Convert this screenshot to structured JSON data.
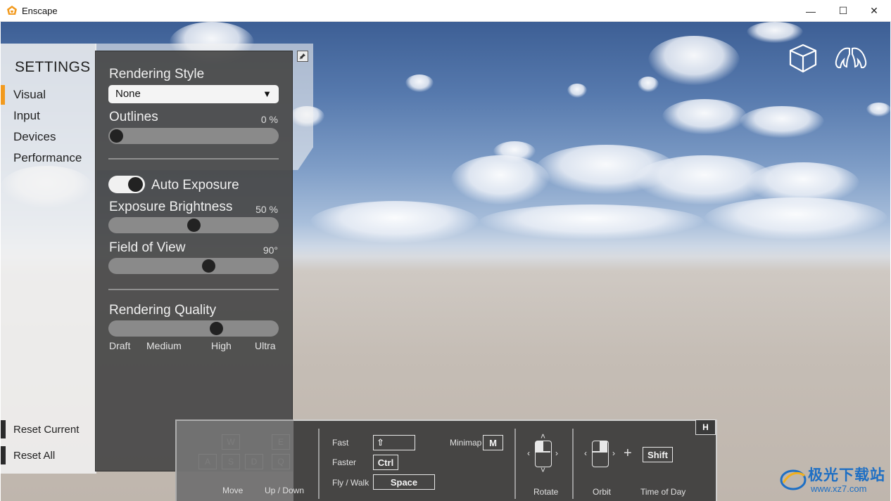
{
  "window": {
    "title": "Enscape",
    "minimize": "—",
    "maximize": "☐",
    "close": "✕"
  },
  "sidebar": {
    "title": "SETTINGS",
    "items": [
      {
        "label": "Visual",
        "active": true
      },
      {
        "label": "Input"
      },
      {
        "label": "Devices"
      },
      {
        "label": "Performance"
      }
    ],
    "reset_current": "Reset Current",
    "reset_all": "Reset All"
  },
  "panel": {
    "rendering_style_label": "Rendering Style",
    "rendering_style_value": "None",
    "outlines_label": "Outlines",
    "outlines_value": "0 %",
    "outlines_level": 0,
    "auto_exposure_label": "Auto Exposure",
    "auto_exposure_on": true,
    "exposure_label": "Exposure Brightness",
    "exposure_value": "50 %",
    "exposure_level": 0.5,
    "fov_label": "Field of View",
    "fov_value": "90°",
    "fov_level": 0.6,
    "quality_label": "Rendering Quality",
    "quality_level": 0.65,
    "quality_ticks": [
      "Draft",
      "Medium",
      "High",
      "Ultra"
    ]
  },
  "help": {
    "keys_move": [
      "W",
      "A",
      "S",
      "D"
    ],
    "keys_updown": [
      "E",
      "Q"
    ],
    "move_label": "Move",
    "updown_label": "Up / Down",
    "fast_label": "Fast",
    "fast_key": "⇧",
    "faster_label": "Faster",
    "faster_key": "Ctrl",
    "flywalk_label": "Fly /  Walk",
    "flywalk_key": "Space",
    "minimap_label": "Minimap",
    "minimap_key": "M",
    "rotate_label": "Rotate",
    "orbit_label": "Orbit",
    "plus": "+",
    "tod_key": "Shift",
    "tod_label": "Time of Day",
    "toggle_key": "H"
  },
  "watermark": {
    "text": "极光下载站",
    "url": "www.xz7.com"
  }
}
